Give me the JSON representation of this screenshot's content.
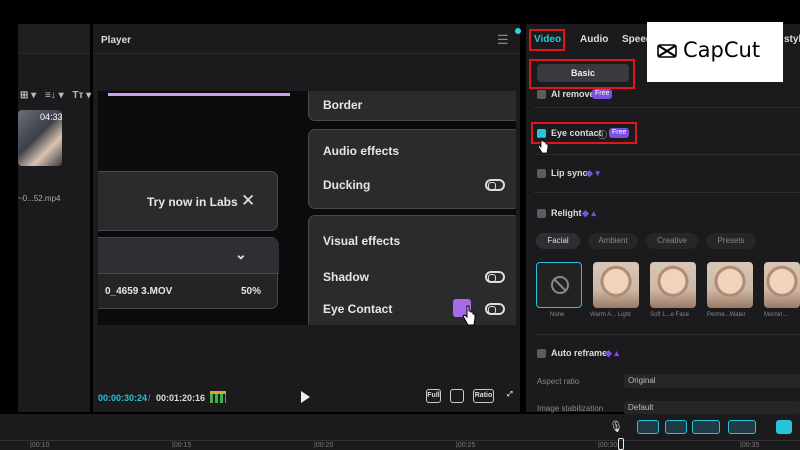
{
  "media": {
    "thumb_duration": "04:33",
    "file_name": "~0...52.mp4",
    "tools": [
      "⊞ ▾",
      "≡↓ ▾",
      "Tᴛ ▾"
    ]
  },
  "player": {
    "title": "Player",
    "current_time": "00:00:30:24",
    "separator": "/",
    "total_time": "00:01:20:16",
    "tools": [
      "Full",
      "Ratio"
    ],
    "canvas": {
      "border_label": "Border",
      "labs_text": "Try now in Labs",
      "file_name": "0_4659 3.MOV",
      "progress": "50%",
      "audio_effects": "Audio effects",
      "ducking": "Ducking",
      "visual_effects": "Visual effects",
      "shadow": "Shadow",
      "eye_contact": "Eye Contact"
    }
  },
  "inspector": {
    "tabs": [
      "Video",
      "Audio",
      "Speed",
      "styl"
    ],
    "basic_button": "Basic",
    "ai_remove_label": "AI remove",
    "eye_contact": "Eye contact",
    "free_badge": "Free",
    "lip_sync": "Lip sync",
    "relight": "Relight",
    "relight_tabs": [
      "Facial",
      "Ambient",
      "Creative",
      "Presets"
    ],
    "presets": [
      "None",
      "Warm A... Light",
      "Soft L...e Face",
      "Perme...Water",
      "Mornin..."
    ],
    "auto_reframe": "Auto reframe",
    "aspect_ratio_label": "Aspect ratio",
    "aspect_ratio_value": "Original",
    "stabilization_label": "Image stabilization",
    "stabilization_value": "Default"
  },
  "logo": {
    "text": "CapCut"
  },
  "timeline": {
    "ticks": [
      "|00:10",
      "|00:15",
      "|00:20",
      "|00:25",
      "|00:30",
      "|00:35"
    ]
  },
  "colors": {
    "accent": "#27c3d6",
    "highlight_box": "#e0161c",
    "badge": "#7b4fe0"
  }
}
